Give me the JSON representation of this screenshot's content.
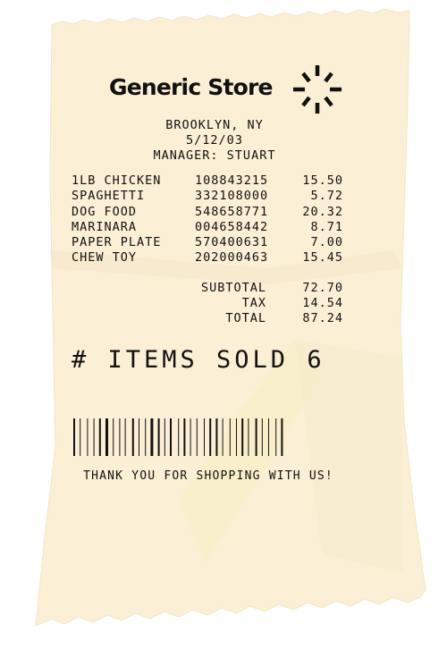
{
  "receipt": {
    "store_name": "Generic Store",
    "logo_icon": "sunburst-icon",
    "location": "BROOKLYN, NY",
    "date": "5/12/03",
    "manager": "MANAGER: STUART",
    "items": [
      {
        "name": "1LB CHICKEN",
        "code": "108843215",
        "price": "15.50"
      },
      {
        "name": "SPAGHETTI",
        "code": "332108000",
        "price": "5.72"
      },
      {
        "name": "DOG FOOD",
        "code": "548658771",
        "price": "20.32"
      },
      {
        "name": "MARINARA",
        "code": "004658442",
        "price": "8.71"
      },
      {
        "name": "PAPER PLATE",
        "code": "570400631",
        "price": "7.00"
      },
      {
        "name": "CHEW TOY",
        "code": "202000463",
        "price": "15.45"
      }
    ],
    "totals": {
      "subtotal_label": "SUBTOTAL",
      "subtotal": "72.70",
      "tax_label": "TAX",
      "tax": "14.54",
      "total_label": "TOTAL",
      "total": "87.24"
    },
    "items_sold": "# ITEMS SOLD 6",
    "thank_you": "THANK YOU FOR SHOPPING WITH US!",
    "paper_color": "#fbefd6",
    "ink_color": "#111111"
  }
}
